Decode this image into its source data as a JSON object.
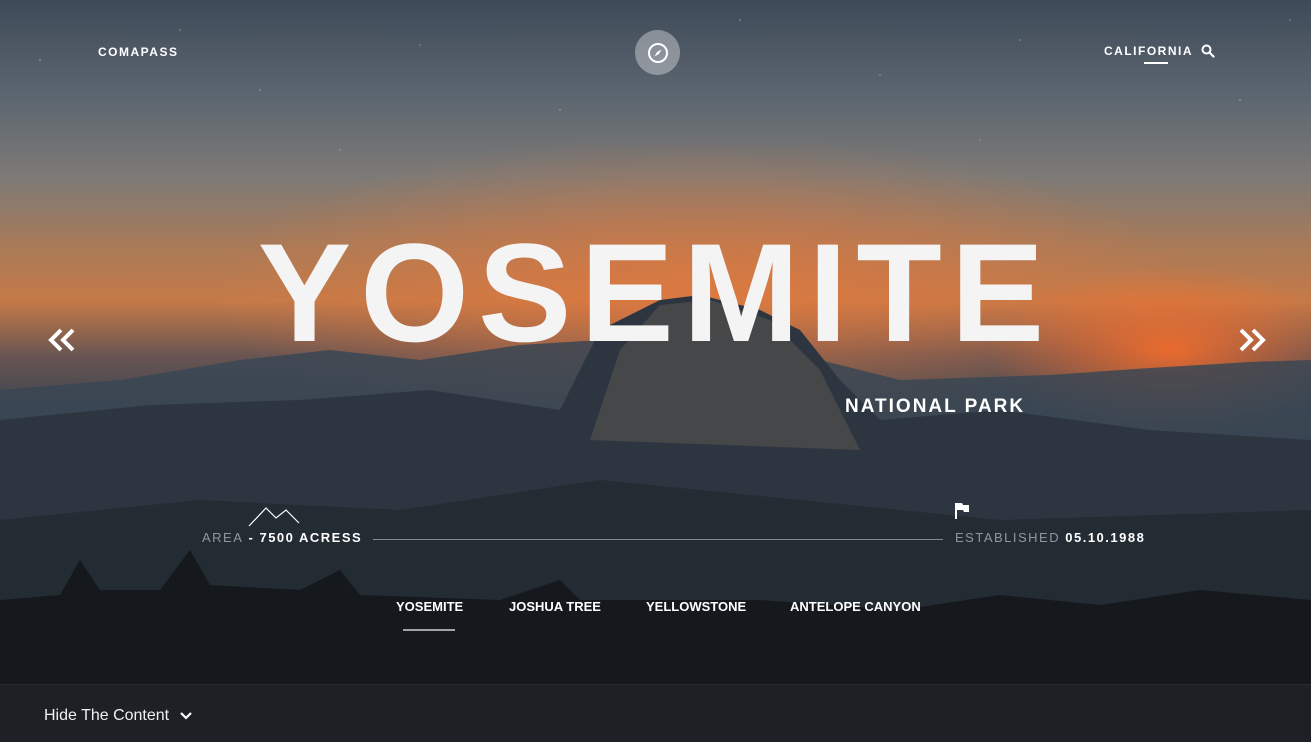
{
  "header": {
    "brand": "COMAPASS",
    "region": "CALIFORNIA"
  },
  "hero": {
    "title": "YOSEMITE",
    "subtitle": "NATIONAL PARK"
  },
  "stats": {
    "area_label": "AREA",
    "area_value": " - 7500 ACRESS",
    "established_label": "ESTABLISHED",
    "established_value": "05.10.1988"
  },
  "tabs": [
    {
      "label": "YOSEMITE",
      "active": true
    },
    {
      "label": "JOSHUA TREE",
      "active": false
    },
    {
      "label": "YELLOWSTONE",
      "active": false
    },
    {
      "label": "ANTELOPE CANYON",
      "active": false
    }
  ],
  "footer": {
    "toggle_label": "Hide The Content"
  },
  "icons": {
    "compass": "compass-icon",
    "search": "search-icon",
    "prev": "double-chevron-left-icon",
    "next": "double-chevron-right-icon",
    "mountain": "mountain-icon",
    "flag": "flag-icon",
    "chevron": "chevron-down-icon"
  },
  "colors": {
    "accent_sunset": "#c57a48",
    "footer_bg": "#1d2126"
  }
}
